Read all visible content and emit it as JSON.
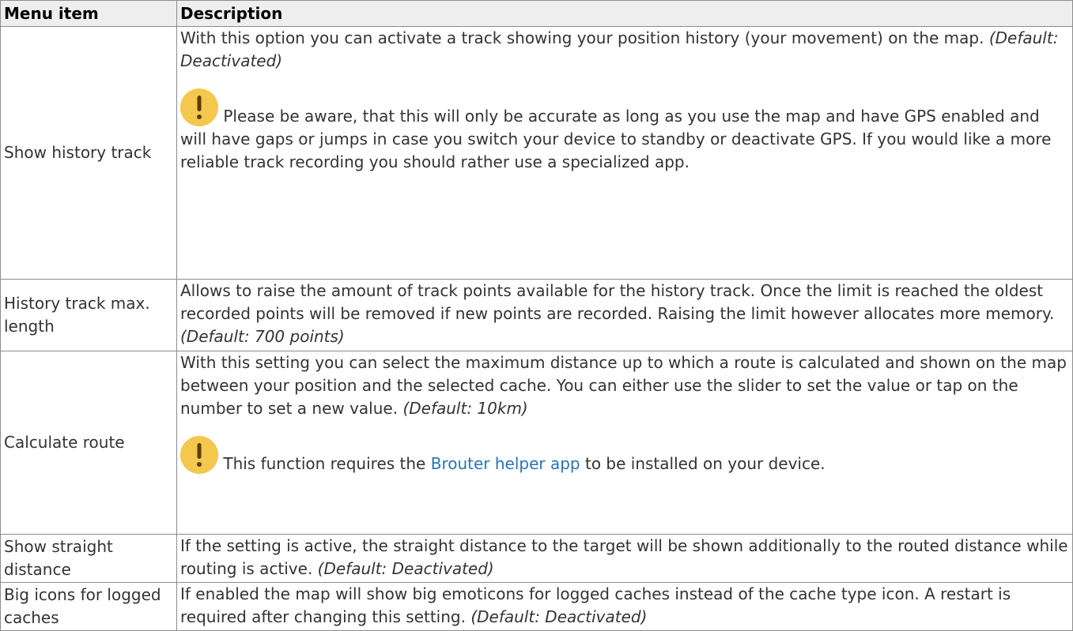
{
  "table": {
    "headers": {
      "menu_item": "Menu item",
      "description": "Description"
    },
    "rows": [
      {
        "item": "Show history track",
        "text": "With this option you can activate a track showing your position history (your movement) on the map.",
        "default": "(Default: Deactivated)",
        "warning": "Please be aware, that this will only be accurate as long as you use the map and have GPS enabled and will have gaps or jumps in case you switch your device to standby or deactivate GPS. If you would like a more reliable track recording you should rather use a specialized app."
      },
      {
        "item": "History track max. length",
        "text": "Allows to raise the amount of track points available for the history track. Once the limit is reached the oldest recorded points will be removed if new points are recorded. Raising the limit however allocates more memory.",
        "default": "(Default: 700 points)"
      },
      {
        "item": "Calculate route",
        "text": "With this setting you can select the maximum distance up to which a route is calculated and shown on the map between your position and the selected cache. You can either use the slider to set the value or tap on the number to set a new value.",
        "default": "(Default: 10km)",
        "warning_before": "This function requires the",
        "warning_link": "Brouter helper app",
        "warning_after": "to be installed on your device."
      },
      {
        "item": "Show straight distance",
        "text": "If the setting is active, the straight distance to the target will be shown additionally to the routed distance while routing is active.",
        "default": "(Default: Deactivated)"
      },
      {
        "item": "Big icons for logged caches",
        "text": "If enabled the map will show big emoticons for logged caches instead of the cache type icon. A restart is required after changing this setting.",
        "default": "(Default: Deactivated)"
      }
    ]
  },
  "icons": {
    "warning": "exclamation-warning-icon"
  },
  "colors": {
    "warning_icon": "#f4c74d",
    "link": "#2b73b7",
    "header_bg": "#eeeeee",
    "border": "#8c8c8c"
  }
}
